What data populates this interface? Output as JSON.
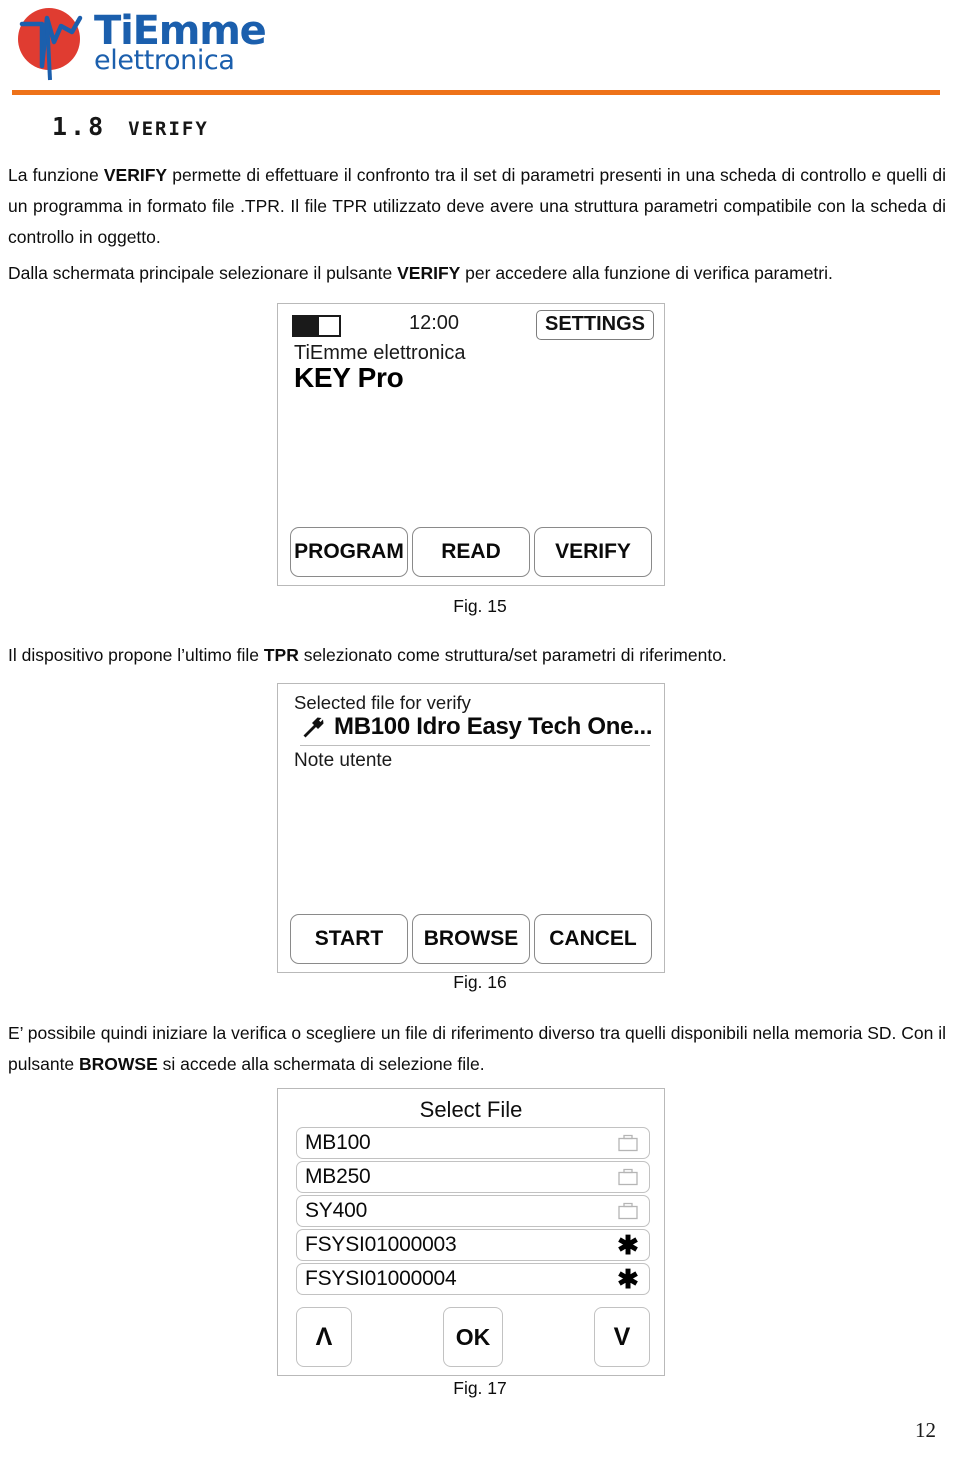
{
  "brand": {
    "logo_title": "TiEmme",
    "logo_subtitle": "elettronica",
    "accent_color": "#ee7219",
    "logo_blue": "#1b5fad",
    "logo_red": "#e03c31"
  },
  "section": {
    "number": "1.8",
    "title": "Verify"
  },
  "paragraphs": {
    "p1_a": "La funzione ",
    "p1_b": "VERIFY",
    "p1_c": " permette di effettuare il confronto tra il set di parametri presenti in una scheda di controllo e quelli di un programma in formato file .TPR. Il file TPR utilizzato deve avere una struttura parametri compatibile con la scheda di controllo in oggetto.",
    "p2_a": "Dalla schermata principale selezionare il pulsante ",
    "p2_b": "VERIFY",
    "p2_c": " per accedere alla funzione di verifica parametri.",
    "p3_a": "Il dispositivo propone l’ultimo file ",
    "p3_b": "TPR",
    "p3_c": " selezionato come struttura/set parametri di riferimento.",
    "p4_a": "E’ possibile quindi iniziare la verifica o scegliere un file di riferimento diverso tra quelli disponibili nella memoria SD. Con il pulsante ",
    "p4_b": "BROWSE",
    "p4_c": " si accede alla schermata di selezione file."
  },
  "fig15": {
    "caption": "Fig. 15",
    "clock": "12:00",
    "settings_label": "SETTINGS",
    "brand_line": "TiEmme elettronica",
    "device_name": "KEY Pro",
    "battery_icon": "battery-icon",
    "buttons": [
      {
        "label": "PROGRAM",
        "name": "program-button"
      },
      {
        "label": "READ",
        "name": "read-button"
      },
      {
        "label": "VERIFY",
        "name": "verify-button"
      }
    ]
  },
  "fig16": {
    "caption": "Fig. 16",
    "selected_label": "Selected file for verify",
    "file_icon": "wrench-icon",
    "file_name": "MB100 Idro Easy Tech One...",
    "note_label": "Note utente",
    "buttons": [
      {
        "label": "START",
        "name": "start-button"
      },
      {
        "label": "BROWSE",
        "name": "browse-button"
      },
      {
        "label": "CANCEL",
        "name": "cancel-button"
      }
    ]
  },
  "fig17": {
    "caption": "Fig. 17",
    "title": "Select File",
    "items": [
      {
        "label": "MB100",
        "icon": "folder-icon"
      },
      {
        "label": "MB250",
        "icon": "folder-icon"
      },
      {
        "label": "SY400",
        "icon": "folder-icon"
      },
      {
        "label": "FSYSI01000003",
        "icon": "asterisk-icon"
      },
      {
        "label": "FSYSI01000004",
        "icon": "asterisk-icon"
      }
    ],
    "nav": {
      "up": "Λ",
      "ok": "OK",
      "down": "V"
    }
  },
  "footer": {
    "page_number": "12"
  }
}
